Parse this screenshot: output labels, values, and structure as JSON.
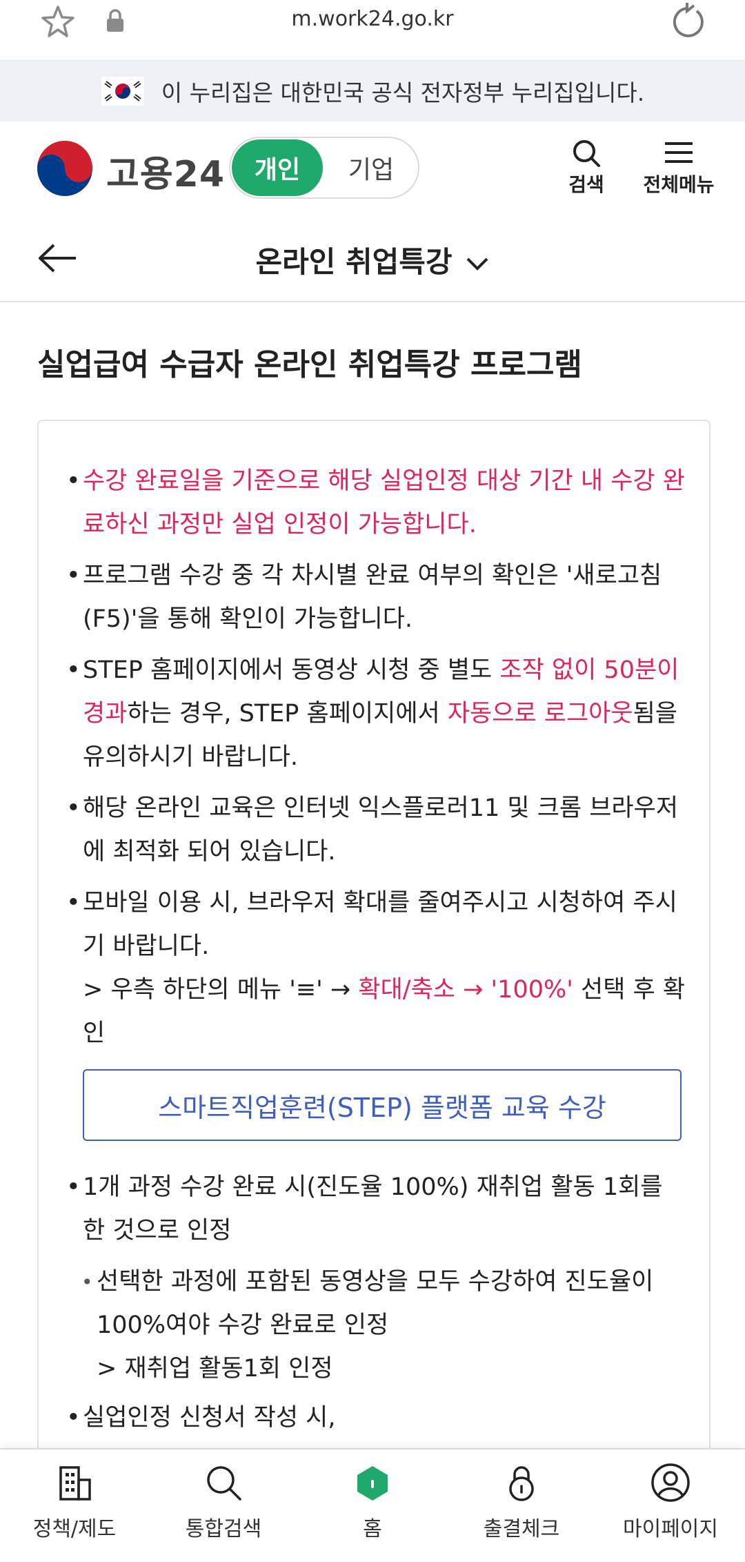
{
  "browser": {
    "url": "m.work24.go.kr"
  },
  "gov_notice": {
    "text": "이 누리집은 대한민국 공식 전자정부 누리집입니다."
  },
  "header": {
    "logo_text": "고용24",
    "toggle_personal": "개인",
    "toggle_corporate": "기업",
    "search_label": "검색",
    "menu_label": "전체메뉴"
  },
  "subheader": {
    "title": "온라인 취업특강"
  },
  "content": {
    "title": "실업급여 수급자 온라인 취업특강 프로그램",
    "items": [
      {
        "text": "수강 완료일을 기준으로 해당 실업인정 대상 기간 내 수강 완료하신 과정만 실업 인정이 가능합니다."
      },
      {
        "text": "프로그램 수강 중 각 차시별 완료 여부의 확인은 '새로고침(F5)'을 통해 확인이 가능합니다."
      },
      {
        "p1": "STEP 홈페이지에서 동영상 시청 중 별도 ",
        "r1": "조작 없이 50분이 경과",
        "p2": "하는 경우, STEP 홈페이지에서 ",
        "r2": "자동으로 로그아웃",
        "p3": "됨을 유의하시기 바랍니다."
      },
      {
        "text": "해당 온라인 교육은 인터넷 익스플로러11 및 크롬 브라우저에 최적화 되어 있습니다."
      },
      {
        "text": "모바일 이용 시, 브라우저 확대를 줄여주시고 시청하여 주시기 바랍니다.",
        "p1": "> 우측 하단의 메뉴 '≡' → ",
        "r1": "확대/축소 → '100%'",
        "p2": " 선택 후 확인"
      }
    ],
    "step_button": "스마트직업훈련(STEP) 플랫폼 교육 수강",
    "items2": [
      {
        "text": "1개 과정 수강 완료 시(진도율 100%) 재취업 활동 1회를 한 것으로 인정"
      }
    ],
    "subitems": [
      {
        "text": "선택한 과정에 포함된 동영상을 모두 수강하여 진도율이 100%여야 수강 완료로 인정",
        "note": "> 재취업 활동1회 인정"
      }
    ],
    "items3": [
      {
        "text": "실업인정 신청서 작성 시,"
      }
    ]
  },
  "bottom_nav": [
    {
      "label": "정책/제도",
      "icon": "building-icon"
    },
    {
      "label": "통합검색",
      "icon": "search-icon"
    },
    {
      "label": "홈",
      "icon": "home-icon"
    },
    {
      "label": "출결체크",
      "icon": "lock-icon"
    },
    {
      "label": "마이페이지",
      "icon": "user-icon"
    }
  ],
  "colors": {
    "accent_green": "#1fa96b",
    "alert_red": "#e0245a",
    "link_blue": "#3d5fc4"
  }
}
